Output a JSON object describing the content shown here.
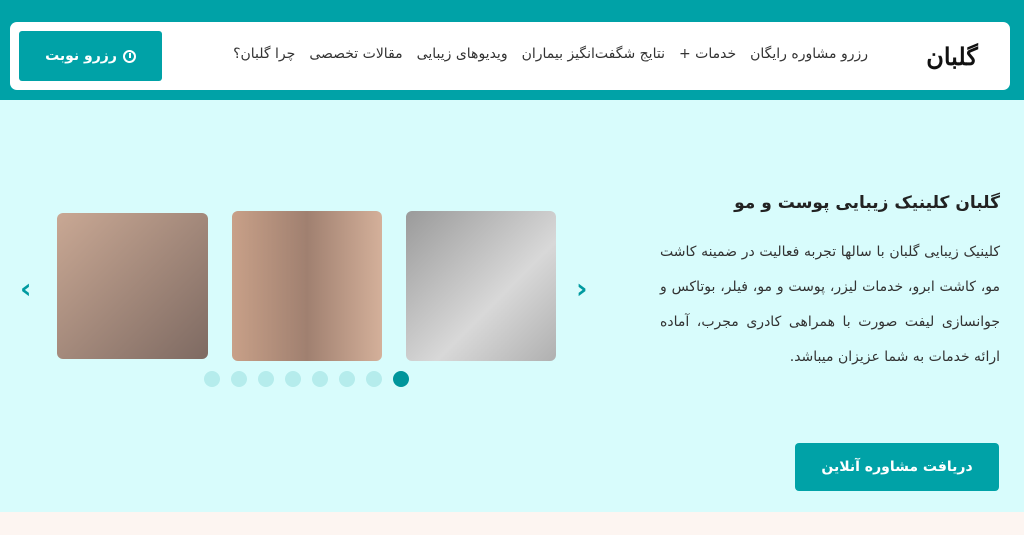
{
  "header": {
    "logo_text": "گلبان",
    "nav": [
      "رزرو مشاوره رایگان",
      "خدمات +",
      "نتایج شگفت‌انگیز بیماران",
      "ویدیوهای زیبایی",
      "مقالات تخصصی",
      "چرا گلبان؟"
    ],
    "book_button": "رزرو نوبت",
    "book_icon": "clock-icon"
  },
  "hero": {
    "title": "گلبان کلینیک زیبایی پوست و مو",
    "description": "کلینیک زیبایی گلبان با سالها تجربه فعالیت در ضمینه کاشت مو، کاشت ابرو، خدمات لیزر، پوست و مو، فیلر، بوتاکس و جوانسازی لیفت صورت با همراهی کادری مجرب، آماده ارائه خدمات به شما عزیزان میباشد.",
    "cta": "دریافت مشاوره آنلاین"
  },
  "slider": {
    "slide_count": 8,
    "active_index": 8,
    "prev_icon": "chevron-left-icon",
    "next_icon": "chevron-right-icon"
  },
  "colors": {
    "brand": "#00a2a7",
    "background": "#d8fcfc"
  }
}
